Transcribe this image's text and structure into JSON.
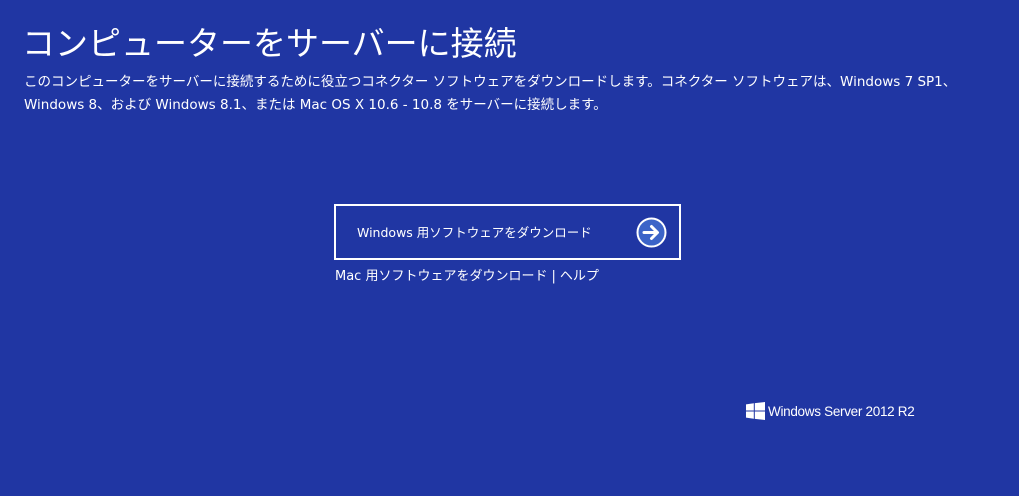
{
  "page": {
    "title": "コンピューターをサーバーに接続",
    "intro": "このコンピューターをサーバーに接続するために役立つコネクター ソフトウェアをダウンロードします。コネクター ソフトウェアは、Windows 7 SP1、Windows 8、および Windows 8.1、または Mac OS X 10.6 - 10.8 をサーバーに接続します。"
  },
  "download": {
    "windows_label": "Windows 用ソフトウェアをダウンロード",
    "windows_icon": "arrow-right-circle-icon",
    "mac_label": "Mac 用ソフトウェアをダウンロード",
    "separator": "|",
    "help_label": "ヘルプ"
  },
  "brand": {
    "logo_icon": "windows-logo-icon",
    "text": "Windows Server 2012 R2"
  },
  "colors": {
    "background": "#2036a3",
    "foreground": "#ffffff",
    "arrow_fill": "#3c64c8"
  }
}
